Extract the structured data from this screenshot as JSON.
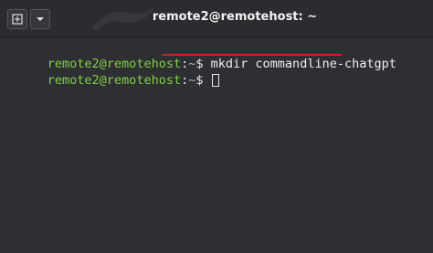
{
  "window": {
    "title": "remote2@remotehost: ~"
  },
  "titlebar": {
    "new_tab_icon": "new-tab-icon",
    "menu_icon": "chevron-down-icon"
  },
  "terminal": {
    "lines": [
      {
        "user_host": "remote2@remotehost",
        "separator": ":",
        "path": "~",
        "symbol": "$",
        "command": "mkdir commandline-chatgpt"
      },
      {
        "user_host": "remote2@remotehost",
        "separator": ":",
        "path": "~",
        "symbol": "$",
        "command": ""
      }
    ]
  },
  "colors": {
    "background": "#2e2f32",
    "titlebar": "#2b2c2f",
    "prompt_user": "#7fd144",
    "highlight_underline": "#d01f1f"
  }
}
